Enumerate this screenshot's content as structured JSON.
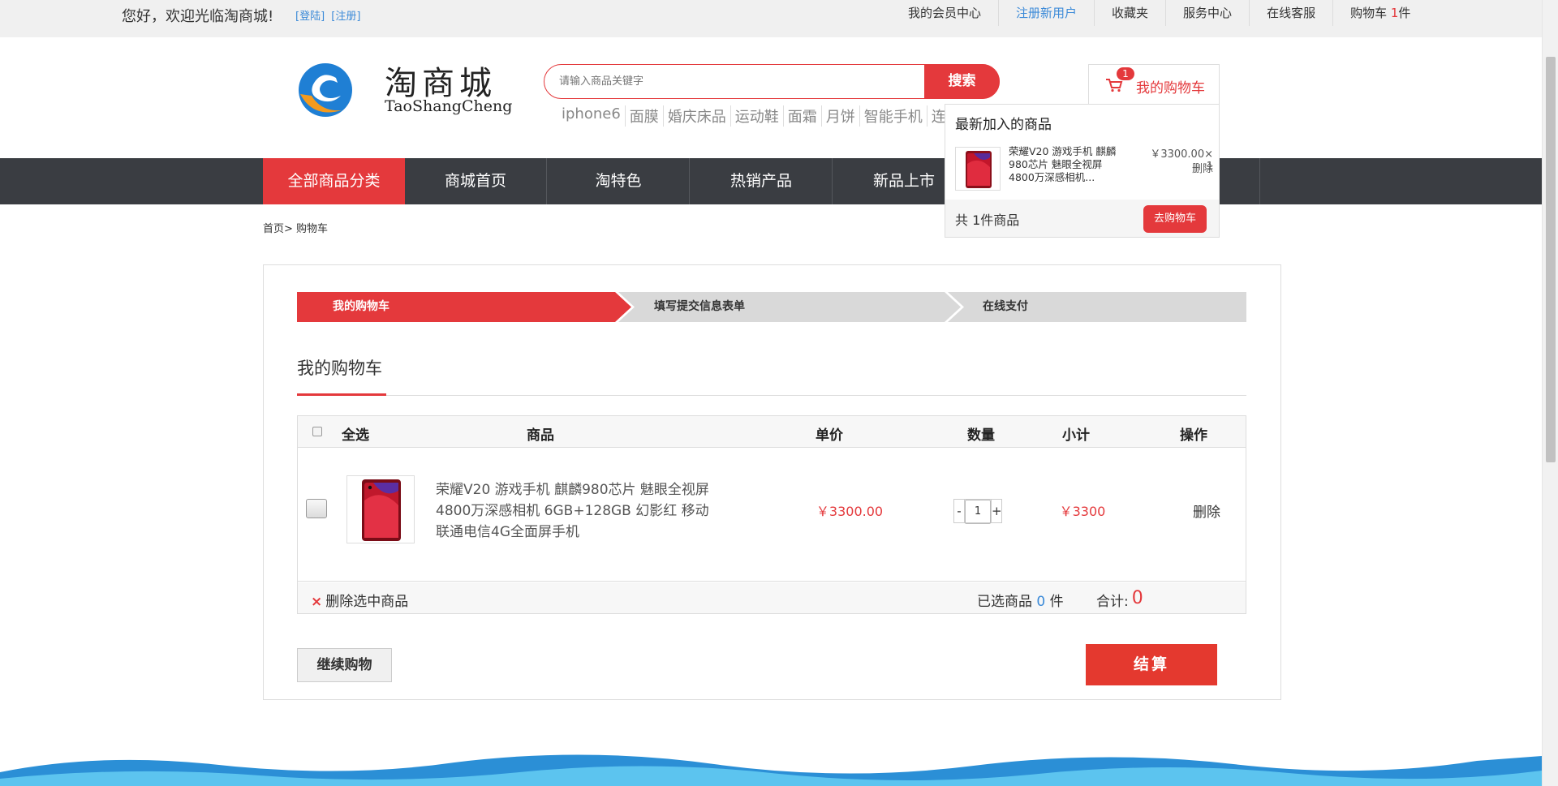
{
  "topbar": {
    "welcome": "您好，欢迎光临淘商城!",
    "login": "[登陆]",
    "register": "[注册]",
    "links": [
      "我的会员中心",
      "注册新用户",
      "收藏夹",
      "服务中心",
      "在线客服"
    ],
    "cart_prefix": "购物车 ",
    "cart_count": "1",
    "cart_suffix": "件"
  },
  "logo": {
    "cn": "淘商城",
    "en": "TaoShangCheng"
  },
  "search": {
    "placeholder": "请输入商品关键字",
    "button": "搜索"
  },
  "hotwords": [
    "iphone6",
    "面膜",
    "婚庆床品",
    "运动鞋",
    "面霜",
    "月饼",
    "智能手机",
    "连"
  ],
  "mini_cart": {
    "badge": "1",
    "label": "我的购物车",
    "dropdown_title": "最新加入的商品",
    "item_name": "荣耀V20 游戏手机 麒麟980芯片 魅眼全视屏 4800万深感相机...",
    "item_price": "￥3300.00× 1",
    "item_delete": "删除",
    "count_text": "共 1件商品",
    "go_button": "去购物车"
  },
  "nav": [
    "全部商品分类",
    "商城首页",
    "淘特色",
    "热销产品",
    "新品上市"
  ],
  "breadcrumb": {
    "home": "首页>",
    "current": " 购物车"
  },
  "steps": [
    "我的购物车",
    "填写提交信息表单",
    "在线支付"
  ],
  "cart_heading": "我的购物车",
  "table": {
    "headers": {
      "select_all": "全选",
      "product": "商品",
      "unit_price": "单价",
      "quantity": "数量",
      "subtotal": "小计",
      "action": "操作"
    },
    "rows": [
      {
        "name": "荣耀V20 游戏手机 麒麟980芯片 魅眼全视屏 4800万深感相机 6GB+128GB 幻影红 移动联通电信4G全面屏手机",
        "price": "￥3300.00",
        "qty": "1",
        "subtotal": "￥3300",
        "action": "删除"
      }
    ],
    "footer": {
      "delete_selected": "删除选中商品",
      "selected_prefix": "已选商品 ",
      "selected_count": "0",
      "selected_suffix": " 件",
      "total_label": "合计:",
      "total_value": "0"
    }
  },
  "buttons": {
    "continue": "继续购物",
    "checkout": "结算"
  },
  "colors": {
    "accent": "#e4393c",
    "nav_bg": "#3a3d42",
    "link_blue": "#3b8ad8",
    "step_inactive": "#d9d9d9"
  },
  "icons": [
    "cart-icon",
    "close-x-icon",
    "logo-mark"
  ]
}
